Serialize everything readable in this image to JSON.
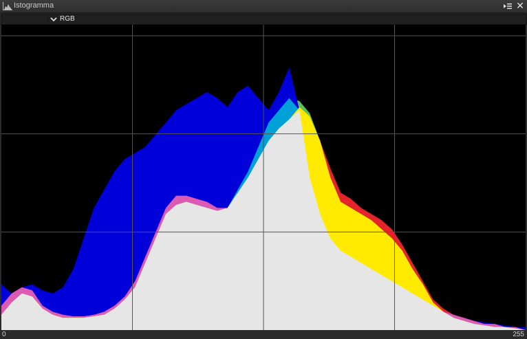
{
  "window": {
    "title": "Istogramma"
  },
  "toolbar": {
    "channel_mode": "RGB"
  },
  "histogram": {
    "axis_min_label": "0",
    "axis_max_label": "255",
    "colors": {
      "background": "#000000",
      "grid": "#555555",
      "red": "#e5232b",
      "green": "#5cbf5c",
      "blue": "#0000d8",
      "cyan": "#00a0d8",
      "magenta": "#dc5ab4",
      "yellow": "#ffea00",
      "white": "#e6e6e6"
    }
  },
  "chart_data": {
    "type": "area",
    "x_range": [
      0,
      255
    ],
    "y_range": [
      0,
      1
    ],
    "x": [
      0,
      5,
      10,
      15,
      20,
      25,
      30,
      35,
      40,
      45,
      50,
      55,
      60,
      65,
      70,
      75,
      80,
      85,
      90,
      95,
      100,
      105,
      110,
      115,
      120,
      125,
      130,
      135,
      140,
      145,
      150,
      155,
      160,
      165,
      170,
      175,
      180,
      185,
      190,
      195,
      200,
      205,
      210,
      215,
      220,
      225,
      230,
      235,
      240,
      245,
      250,
      255
    ],
    "series": [
      {
        "name": "Red",
        "color": "#e5232b",
        "values": [
          0.08,
          0.12,
          0.14,
          0.13,
          0.08,
          0.06,
          0.05,
          0.045,
          0.045,
          0.05,
          0.06,
          0.08,
          0.11,
          0.16,
          0.24,
          0.32,
          0.4,
          0.44,
          0.44,
          0.43,
          0.42,
          0.4,
          0.4,
          0.45,
          0.5,
          0.56,
          0.62,
          0.66,
          0.69,
          0.73,
          0.7,
          0.62,
          0.53,
          0.45,
          0.43,
          0.4,
          0.38,
          0.36,
          0.33,
          0.28,
          0.22,
          0.16,
          0.1,
          0.07,
          0.05,
          0.04,
          0.03,
          0.02,
          0.02,
          0.01,
          0.01,
          0.0
        ]
      },
      {
        "name": "Green",
        "color": "#5cbf5c",
        "values": [
          0.05,
          0.09,
          0.12,
          0.11,
          0.07,
          0.05,
          0.04,
          0.04,
          0.04,
          0.045,
          0.05,
          0.07,
          0.1,
          0.14,
          0.22,
          0.3,
          0.38,
          0.41,
          0.42,
          0.41,
          0.4,
          0.39,
          0.4,
          0.46,
          0.52,
          0.6,
          0.68,
          0.72,
          0.76,
          0.75,
          0.71,
          0.62,
          0.5,
          0.42,
          0.4,
          0.38,
          0.36,
          0.33,
          0.3,
          0.26,
          0.2,
          0.15,
          0.09,
          0.06,
          0.04,
          0.03,
          0.02,
          0.015,
          0.01,
          0.01,
          0.005,
          0.0
        ]
      },
      {
        "name": "Blue",
        "color": "#0000d8",
        "values": [
          0.15,
          0.12,
          0.14,
          0.15,
          0.13,
          0.12,
          0.14,
          0.2,
          0.3,
          0.4,
          0.46,
          0.52,
          0.56,
          0.58,
          0.6,
          0.64,
          0.68,
          0.72,
          0.74,
          0.76,
          0.78,
          0.76,
          0.73,
          0.78,
          0.8,
          0.76,
          0.72,
          0.78,
          0.86,
          0.72,
          0.5,
          0.38,
          0.3,
          0.26,
          0.24,
          0.22,
          0.2,
          0.18,
          0.16,
          0.14,
          0.12,
          0.1,
          0.08,
          0.06,
          0.05,
          0.04,
          0.03,
          0.025,
          0.02,
          0.015,
          0.01,
          0.01
        ]
      }
    ],
    "grid": true,
    "grid_divisions": {
      "x": 4,
      "y": 3
    },
    "legend": "none"
  }
}
